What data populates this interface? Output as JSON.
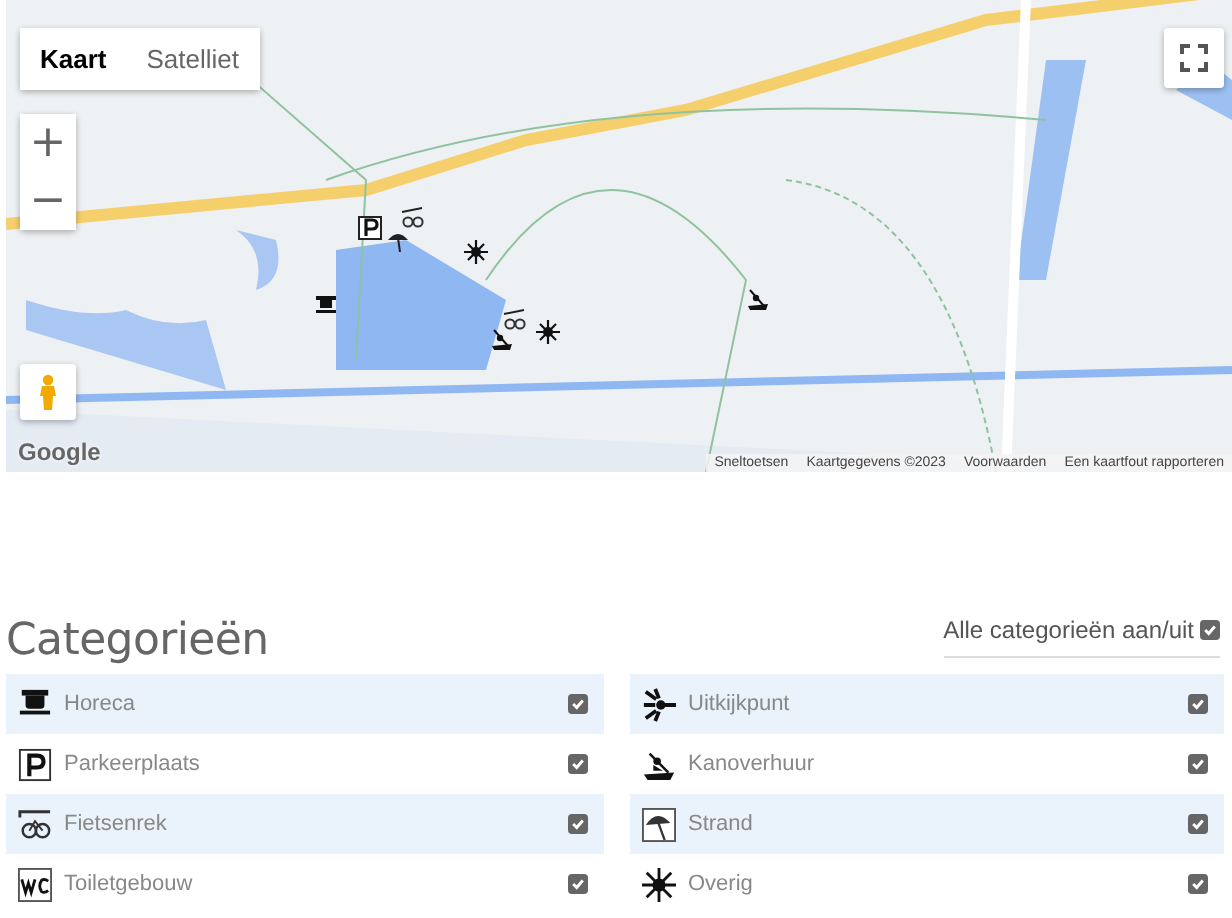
{
  "map": {
    "map_types": [
      {
        "label": "Kaart",
        "selected": true
      },
      {
        "label": "Satelliet",
        "selected": false
      }
    ],
    "zoom_in": "+",
    "zoom_out": "−",
    "logo": "Google",
    "footer": [
      "Sneltoetsen",
      "Kaartgegevens ©2023",
      "Voorwaarden",
      "Een kaartfout rapporteren"
    ]
  },
  "categories_title": "Categorieën",
  "toggle_all": {
    "label": "Alle categorieën aan/uit",
    "checked": true
  },
  "categories": [
    {
      "label": "Horeca",
      "kind": "cup",
      "checked": true
    },
    {
      "label": "Uitkijkpunt",
      "kind": "viewpoint",
      "checked": true
    },
    {
      "label": "Parkeerplaats",
      "kind": "parking",
      "checked": true
    },
    {
      "label": "Kanoverhuur",
      "kind": "canoe",
      "checked": true
    },
    {
      "label": "Fietsenrek",
      "kind": "bike",
      "checked": true
    },
    {
      "label": "Strand",
      "kind": "beach",
      "checked": true
    },
    {
      "label": "Toiletgebouw",
      "kind": "wc",
      "checked": true
    },
    {
      "label": "Overig",
      "kind": "sun",
      "checked": true
    }
  ]
}
